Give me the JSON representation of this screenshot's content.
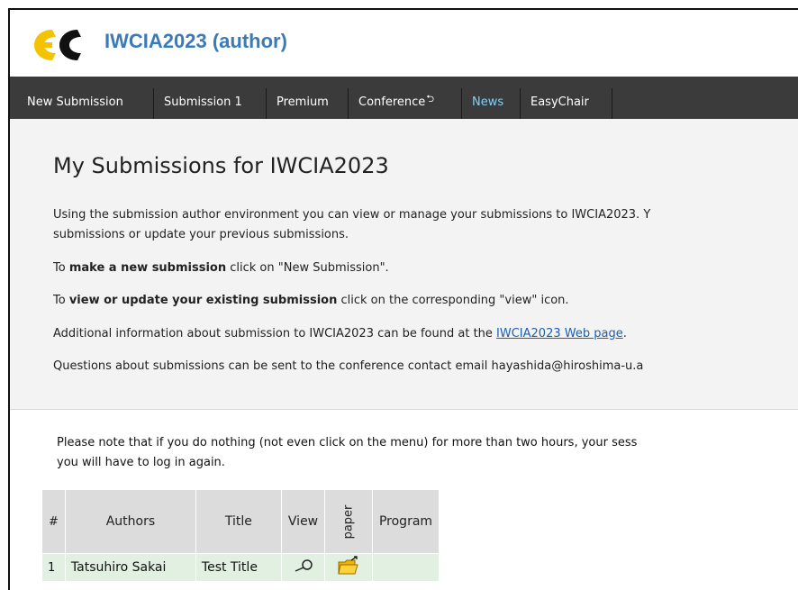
{
  "header": {
    "logo_text": "EC",
    "title": "IWCIA2023 (author)"
  },
  "menu": {
    "items": [
      "New Submission",
      "Submission 1",
      "Premium",
      "Conference",
      "News",
      "EasyChair"
    ]
  },
  "intro": {
    "title": "My Submissions for IWCIA2023",
    "line1": "Using the submission author environment you can view or manage your submissions to IWCIA2023. Y",
    "line2": "submissions or update your previous submissions.",
    "new_prefix": "To ",
    "new_bold": "make a new submission",
    "new_suffix": " click on \"New Submission\".",
    "view_prefix": "To ",
    "view_bold": "view or update your existing submission",
    "view_suffix": " click on the corresponding \"view\" icon.",
    "info_prefix": "Additional information about submission to IWCIA2023 can be found at the ",
    "info_link": "IWCIA2023 Web page",
    "info_suffix": ".",
    "questions": "Questions about submissions can be sent to the conference contact email hayashida@hiroshima-u.a"
  },
  "note": {
    "line1": "Please note that if you do nothing (not even click on the menu) for more than two hours, your sess",
    "line2": "you will have to log in again."
  },
  "table": {
    "headers": [
      "#",
      "Authors",
      "Title",
      "View",
      "paper",
      "Program"
    ],
    "rows": [
      {
        "num": "1",
        "authors": "Tatsuhiro Sakai",
        "title": "Test Title",
        "program": ""
      }
    ]
  },
  "colors": {
    "title_blue": "#3a7ab8",
    "menu_bg": "#3b3b3b",
    "news_color": "#7fd0ff",
    "row_green": "#e1f0e1"
  },
  "icons": {
    "view": "magnifier-icon",
    "paper": "folder-arrow-icon",
    "external": "external-link-icon"
  }
}
